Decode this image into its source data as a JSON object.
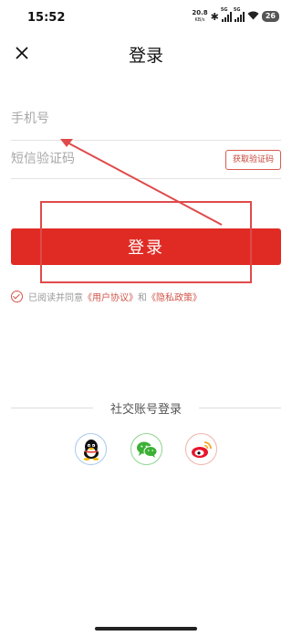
{
  "status_bar": {
    "time": "15:52",
    "net_speed": "20.8",
    "net_speed_unit": "KB/s",
    "sig1_label": "5G",
    "sig2_label": "5G",
    "battery": "26"
  },
  "header": {
    "title": "登录",
    "close_icon": "close-icon"
  },
  "form": {
    "phone_placeholder": "手机号",
    "phone_value": "",
    "code_placeholder": "短信验证码",
    "code_value": "",
    "get_code_label": "获取验证码",
    "login_label": "登录"
  },
  "agreement": {
    "prefix": "已阅读并同意",
    "user_agreement": "《用户协议》",
    "and": "和",
    "privacy_policy": "《隐私政策》",
    "checked": true
  },
  "social": {
    "title": "社交账号登录",
    "icons": [
      "qq-icon",
      "wechat-icon",
      "weibo-icon"
    ]
  },
  "colors": {
    "accent": "#e02b24",
    "annotation": "#e04a4a"
  }
}
